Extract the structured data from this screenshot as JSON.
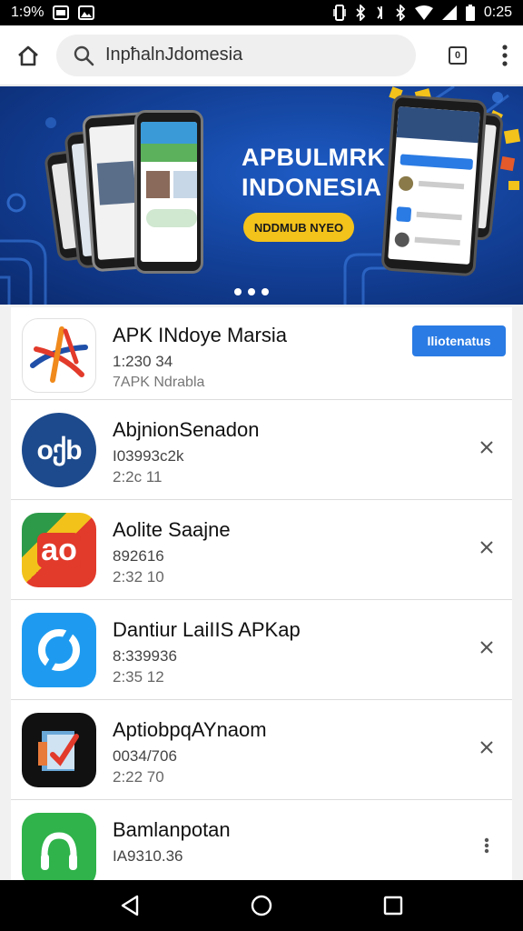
{
  "status_bar": {
    "time_left": "1:9%",
    "clock": "0:25",
    "icons_left": [
      "image-icon",
      "photo-icon"
    ],
    "icons_right": [
      "vibrate-icon",
      "bluetooth-icon",
      "nfc-icon",
      "bluetooth-icon",
      "wifi-icon",
      "signal-icon",
      "battery-icon"
    ]
  },
  "browser": {
    "url": "InpħalnJdomesia"
  },
  "banner": {
    "title_line1": "APBULMRK",
    "title_line2": "INDONESIA",
    "button_label": "NDDMUB NYEO",
    "slide_count": 3
  },
  "apps": [
    {
      "name": "APK INdoye Marsia",
      "meta1": "1:230 34",
      "meta2": "7APK Ndrabla",
      "action": "install",
      "action_label": "Iliotenatus"
    },
    {
      "name": "AbjnionSenadon",
      "meta1": "I03993c2k",
      "meta2": "2:2c 11",
      "action": "close"
    },
    {
      "name": "Aolite Saajne",
      "meta1": "892616",
      "meta2": "2:32 10",
      "action": "close"
    },
    {
      "name": "Dantiur LaiIIS APKap",
      "meta1": "8:339936",
      "meta2": "2:35 12",
      "action": "close"
    },
    {
      "name": "AptiobpqAYnaom",
      "meta1": "0034/706",
      "meta2": "2:22 70",
      "action": "close"
    },
    {
      "name": "Bamlanpotan",
      "meta1": "IA9310.36",
      "meta2": "",
      "action": "more"
    }
  ],
  "colors": {
    "install_button": "#2a7be4",
    "banner_blue": "#123e94",
    "banner_button": "#f3c21b"
  }
}
